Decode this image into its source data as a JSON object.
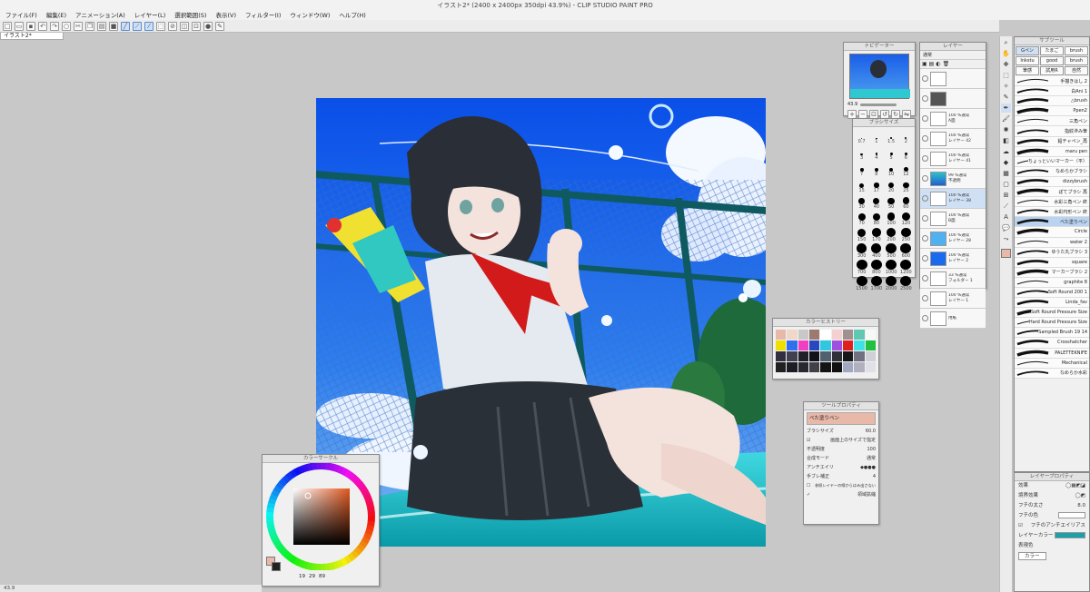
{
  "window": {
    "title": "イラスト2* (2400 x 2400px 350dpi 43.9%) - CLIP STUDIO PAINT PRO"
  },
  "menu": [
    "ファイル(F)",
    "編集(E)",
    "アニメーション(A)",
    "レイヤー(L)",
    "選択範囲(S)",
    "表示(V)",
    "フィルター(I)",
    "ウィンドウ(W)",
    "ヘルプ(H)"
  ],
  "doc_tab": "イラスト2*",
  "navigator": {
    "title": "ナビゲーター",
    "zoom": "43.9"
  },
  "brush_size": {
    "title": "ブラシサイズ",
    "sizes": [
      "0.7",
      "1",
      "1.5",
      "2",
      "3",
      "4",
      "5",
      "6",
      "7",
      "8",
      "10",
      "12",
      "15",
      "17",
      "20",
      "25",
      "30",
      "40",
      "50",
      "60",
      "70",
      "80",
      "100",
      "120",
      "150",
      "170",
      "200",
      "250",
      "300",
      "400",
      "500",
      "600",
      "700",
      "800",
      "1000",
      "1200",
      "1500",
      "1700",
      "2000",
      "2500"
    ]
  },
  "layers": {
    "title": "レイヤー",
    "blend": "通常",
    "rows": [
      {
        "line1": "",
        "line2": ""
      },
      {
        "line1": "",
        "line2": ""
      },
      {
        "line1": "100 %通常",
        "line2": "A面"
      },
      {
        "line1": "100 %通常",
        "line2": "レイヤー 42"
      },
      {
        "line1": "100 %通常",
        "line2": "レイヤー 41"
      },
      {
        "line1": "99 %通常",
        "line2": "不透明"
      },
      {
        "line1": "100 %通常",
        "line2": "レイヤー 38"
      },
      {
        "line1": "100 %通常",
        "line2": "B面"
      },
      {
        "line1": "100 %通常",
        "line2": "レイヤー 28"
      },
      {
        "line1": "100 %通常",
        "line2": "レイヤー 2"
      },
      {
        "line1": "33 %通常",
        "line2": "フォルダー 1"
      },
      {
        "line1": "100 %通常",
        "line2": "レイヤー 1"
      },
      {
        "line1": "",
        "line2": "用紙"
      }
    ]
  },
  "color_history": {
    "title": "カラーヒストリー",
    "swatches": [
      "#e8b8a8",
      "#f0d8c8",
      "#c8c8c8",
      "#9c7a70",
      "#ffffff",
      "#f4d0d0",
      "#a09090",
      "#60c8b0",
      "#f8f8f8",
      "#f0e000",
      "#3070f0",
      "#f040c0",
      "#2848c0",
      "#30c8e0",
      "#a050e0",
      "#e02020",
      "#40e0e8",
      "#20c040",
      "#303040",
      "#404050",
      "#202028",
      "#101018",
      "#506070",
      "#303038",
      "#181818",
      "#707080",
      "#d0d0d8",
      "#202020",
      "#1c1c24",
      "#282830",
      "#404048",
      "#141414",
      "#101010",
      "#a0a8c0",
      "#b0b0c0",
      "#e0e0e8"
    ]
  },
  "tool_property": {
    "title": "ツールプロパティ",
    "tool_name": "べた塗りペン",
    "brush_size_label": "ブラシサイズ",
    "brush_size": "60.0",
    "fit_checkbox": "画面上のサイズで指定",
    "opacity_label": "不透明度",
    "opacity": "100",
    "blend_label": "合成モード",
    "blend": "通常",
    "aa_label": "アンチエイリ",
    "stab_label": "手ブレ補正",
    "stab": "4",
    "ref_checkbox": "参照レイヤーの線からはみ出さない",
    "extra": "領域拡縮"
  },
  "color_wheel": {
    "title": "カラーサークル",
    "h": "19",
    "s": "29",
    "v": "89",
    "main_color": "#e8b8a8",
    "hue_color": "#e05820"
  },
  "sub_tool": {
    "title": "サブツール",
    "tabs": [
      "Gペン",
      "たまご",
      "brush",
      "Inkstu",
      "good",
      "brush",
      "筆感",
      "試用R",
      "自然"
    ],
    "brushes": [
      "手描きはし 2",
      "白Ani 1",
      "△brush",
      "Ppen2",
      "三角ペン",
      "指紋滲み筆",
      "鉛チャペン_再",
      "maru pen",
      "ちょっといいマーカー（平）",
      "なめらかブラシ",
      "dizzybrush",
      "ぽてブラシ 再",
      "水彩三角ペン 終",
      "水彩円形ペン 終",
      "べた塗りペン",
      "Circle",
      "water 2",
      "ゆうた丸ブラシ 3",
      "square",
      "マーカーブラシ 2",
      "graphite 8",
      "Soft Round 200 1",
      "Linda_fav",
      "Soft Round Pressure Size",
      "Hard Round Pressure Size",
      "Sampled Brush 19 14",
      "Crosshatcher",
      "PALETTEKNIFE",
      "Mechanical",
      "なめらか水彩"
    ],
    "selected": 14
  },
  "layer_property": {
    "title": "レイヤープロパティ",
    "effect_label": "効果",
    "border_label": "境界効果",
    "border_width_label": "フチの太さ",
    "border_width": "8.0",
    "border_color_label": "フチの色",
    "aa_checkbox": "フチのアンチエイリアス",
    "layer_color_label": "レイヤーカラー",
    "layer_color": "#1aa0a8",
    "display_color_label": "表現色",
    "display_color": "カラー"
  },
  "status": {
    "zoom": "43.9"
  },
  "accent": "#5b8bd0"
}
